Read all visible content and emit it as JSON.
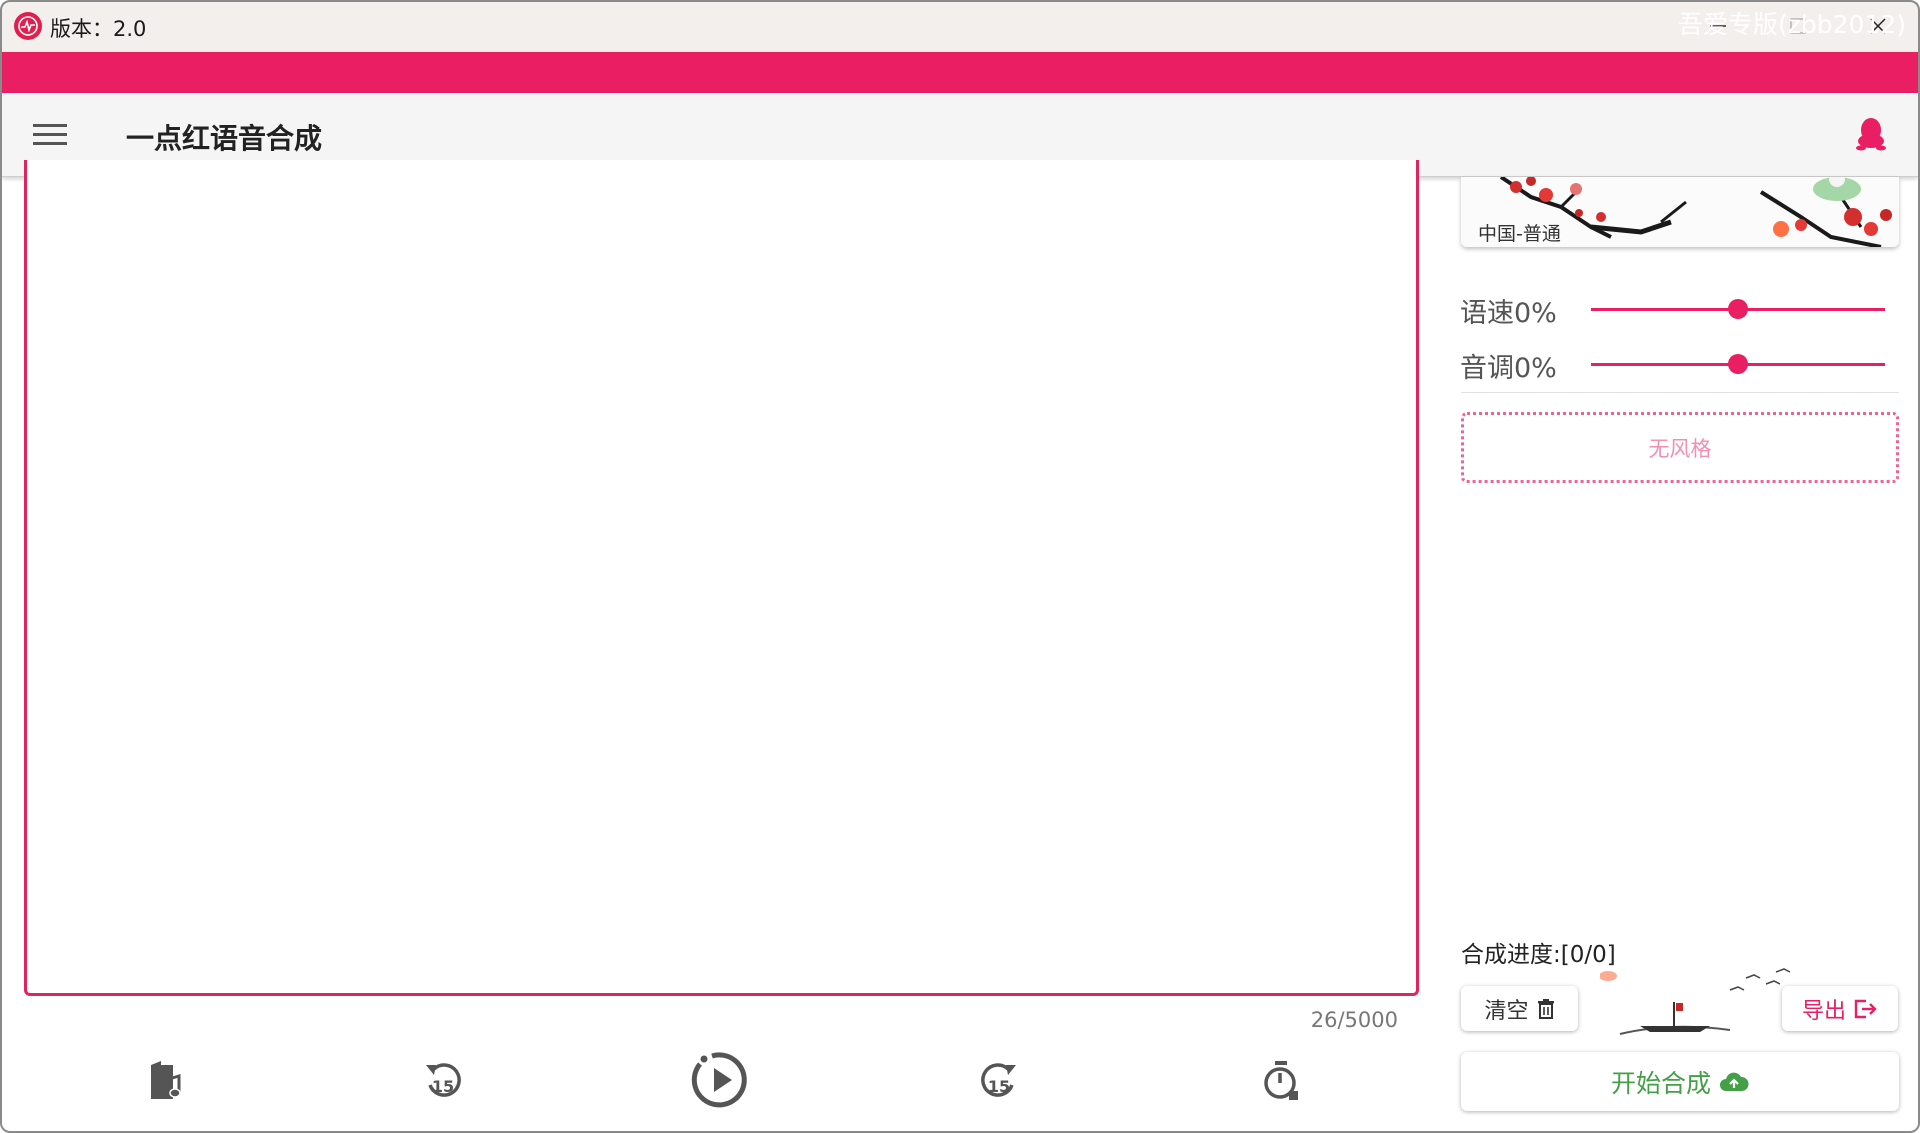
{
  "window": {
    "title": "版本：2.0",
    "minimize_icon": "minimize-icon",
    "maximize_icon": "maximize-icon",
    "close_icon": "close-icon"
  },
  "banner": {
    "text": "吾爱专版(zbb2012)"
  },
  "toolbar": {
    "menu_icon": "hamburger-menu-icon",
    "title": "一点红语音合成",
    "qq_icon": "qq-penguin-icon"
  },
  "editor": {
    "content": "",
    "char_count": "26/5000"
  },
  "controls": {
    "items": [
      {
        "icon": "music-file-icon"
      },
      {
        "icon": "replay-15-icon"
      },
      {
        "icon": "play-icon"
      },
      {
        "icon": "forward-15-icon"
      },
      {
        "icon": "timer-icon"
      }
    ]
  },
  "voice": {
    "label": "中国-普通"
  },
  "sliders": {
    "speed": {
      "label": "语速0%",
      "value_percent": 0
    },
    "pitch": {
      "label": "音调0%",
      "value_percent": 0
    }
  },
  "style": {
    "placeholder": "无风格"
  },
  "progress": {
    "text": "合成进度:[0/0]"
  },
  "buttons": {
    "clear": {
      "label": "清空",
      "icon": "trash-icon"
    },
    "export": {
      "label": "导出",
      "icon": "export-icon"
    },
    "start": {
      "label": "开始合成",
      "icon": "cloud-upload-icon"
    }
  },
  "colors": {
    "accent": "#e91e63",
    "start_text": "#43a047",
    "style_placeholder": "#f48fb1"
  }
}
